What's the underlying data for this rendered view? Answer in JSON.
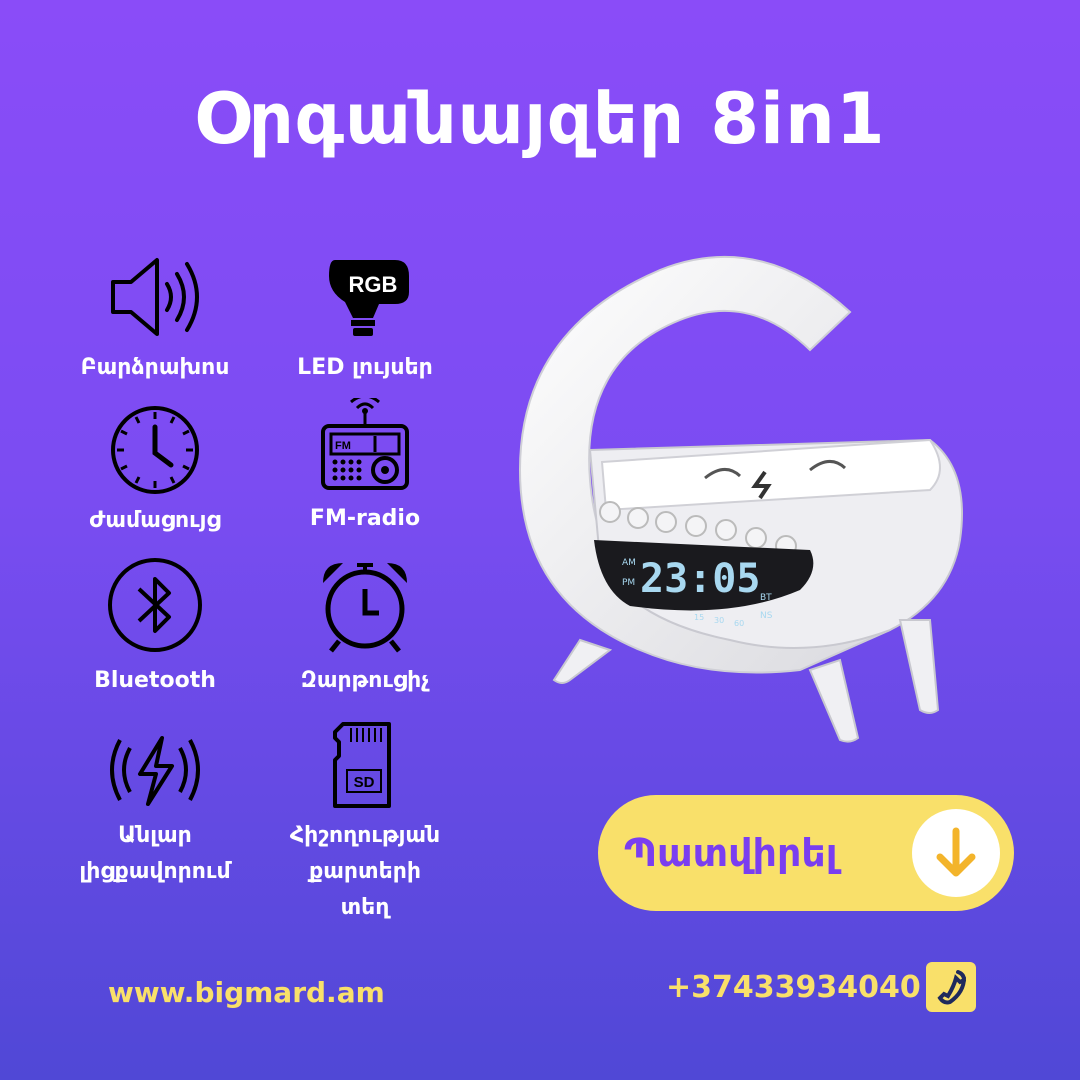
{
  "title": "Օրգանայզեր 8in1",
  "features": [
    {
      "icon": "speaker-icon",
      "label": "Բարձրախոս"
    },
    {
      "icon": "rgb-bulb-icon",
      "label": "LED լույսեր",
      "badge": "RGB"
    },
    {
      "icon": "clock-icon",
      "label": "Ժամացույց"
    },
    {
      "icon": "radio-icon",
      "label": "FM-radio",
      "badge": "FM"
    },
    {
      "icon": "bluetooth-icon",
      "label": "Bluetooth"
    },
    {
      "icon": "alarm-clock-icon",
      "label": "Զարթուցիչ"
    },
    {
      "icon": "wireless-charging-icon",
      "label_lines": [
        "Անլար",
        "լիցքավորում"
      ]
    },
    {
      "icon": "sd-card-icon",
      "label_lines": [
        "Հիշողության",
        "քարտերի",
        "տեղ"
      ],
      "badge": "SD"
    }
  ],
  "product": {
    "display_time": "23:05",
    "display_labels": [
      "AM",
      "PM",
      "BT",
      "NS",
      "15",
      "30",
      "60"
    ]
  },
  "cta": {
    "label": "Պատվիրել",
    "icon": "arrow-down-icon"
  },
  "footer": {
    "url": "www.bigmard.am",
    "phone": "+37433934040",
    "phone_icon": "phone-icon"
  },
  "colors": {
    "accent_yellow": "#f9e06a",
    "cta_text": "#7a3ef0",
    "background_top": "#8a4cf8",
    "background_bottom": "#5048d6"
  }
}
